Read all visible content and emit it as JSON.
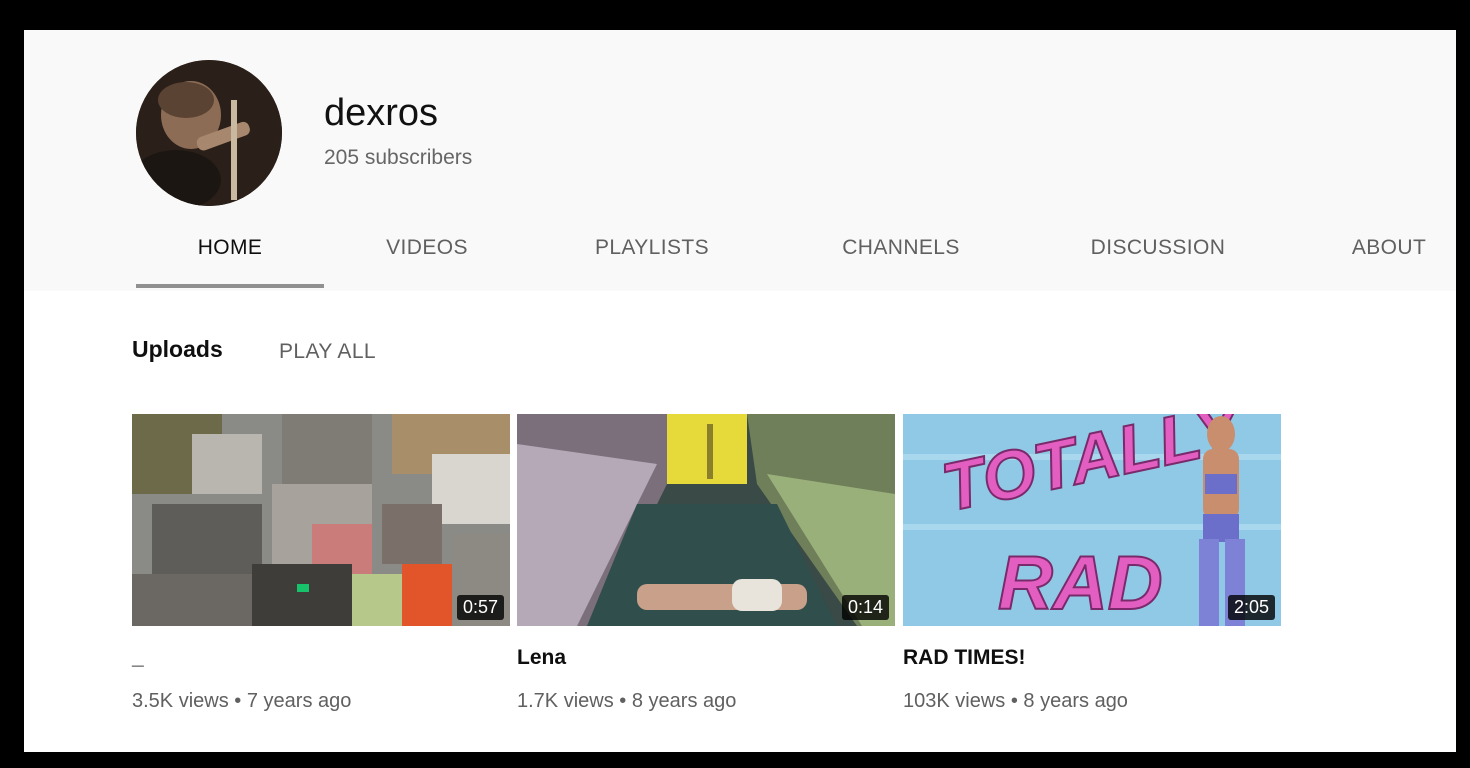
{
  "channel": {
    "name": "dexros",
    "subscribers": "205 subscribers"
  },
  "tabs": [
    {
      "label": "HOME",
      "active": true
    },
    {
      "label": "VIDEOS",
      "active": false
    },
    {
      "label": "PLAYLISTS",
      "active": false
    },
    {
      "label": "CHANNELS",
      "active": false
    },
    {
      "label": "DISCUSSION",
      "active": false
    },
    {
      "label": "ABOUT",
      "active": false
    }
  ],
  "section": {
    "title": "Uploads",
    "play_all": "PLAY ALL"
  },
  "videos": [
    {
      "title": "_",
      "duration": "0:57",
      "views": "3.5K views",
      "age": "7 years ago"
    },
    {
      "title": "Lena",
      "duration": "0:14",
      "views": "1.7K views",
      "age": "8 years ago"
    },
    {
      "title": "RAD TIMES!",
      "duration": "2:05",
      "views": "103K views",
      "age": "8 years ago"
    }
  ],
  "separator": "•",
  "thumbnail_text": {
    "rad_top": "TOTALLY",
    "rad_bottom": "RAD"
  },
  "colors": {
    "header_bg": "#f9f9f9",
    "tab_underline": "#909090"
  }
}
